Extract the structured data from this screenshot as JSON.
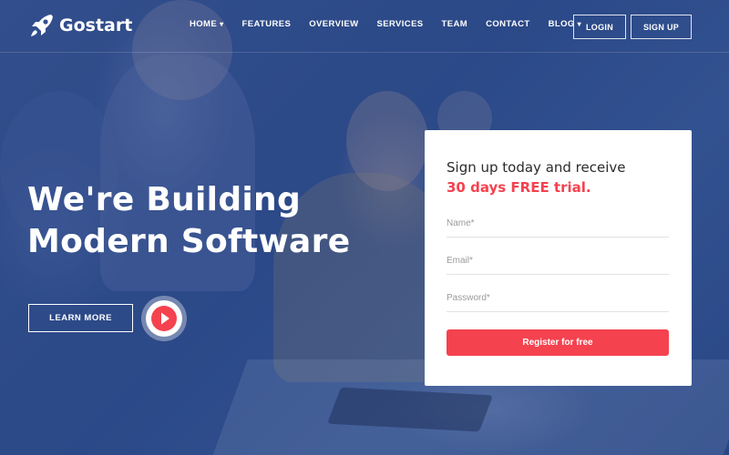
{
  "brand": {
    "name": "Gostart",
    "logo_icon": "rocket-icon"
  },
  "nav": {
    "items": [
      {
        "label": "HOME",
        "has_dropdown": true
      },
      {
        "label": "FEATURES",
        "has_dropdown": false
      },
      {
        "label": "OVERVIEW",
        "has_dropdown": false
      },
      {
        "label": "SERVICES",
        "has_dropdown": false
      },
      {
        "label": "TEAM",
        "has_dropdown": false
      },
      {
        "label": "CONTACT",
        "has_dropdown": false
      },
      {
        "label": "BLOG",
        "has_dropdown": true
      }
    ],
    "login_label": "LOGIN",
    "signup_label": "SIGN UP"
  },
  "hero": {
    "headline_line1": "We're Building",
    "headline_line2": "Modern Software",
    "learn_more_label": "LEARN MORE",
    "play_icon": "play-icon"
  },
  "signup": {
    "title": "Sign up today and receive",
    "highlight": "30 days FREE trial.",
    "name_placeholder": "Name*",
    "email_placeholder": "Email*",
    "password_placeholder": "Password*",
    "submit_label": "Register for free"
  },
  "colors": {
    "accent": "#f5424f",
    "overlay": "#2f4d8c",
    "text_light": "#ffffff"
  }
}
